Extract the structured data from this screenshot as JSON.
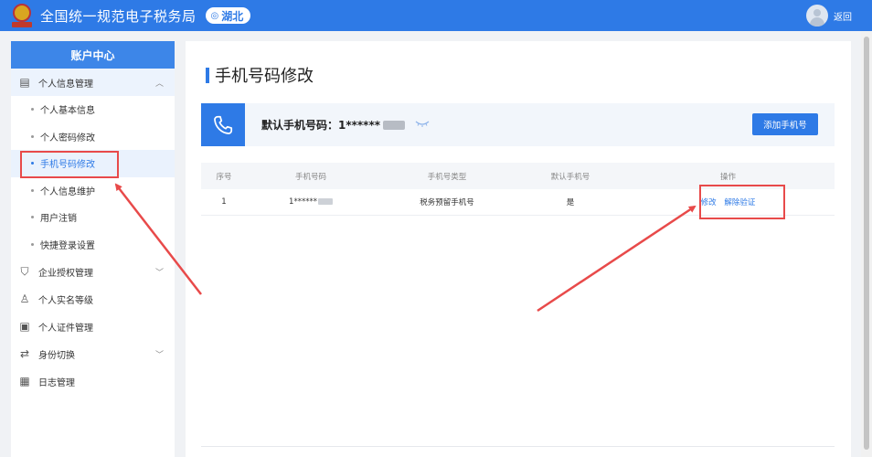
{
  "header": {
    "site_title": "全国统一规范电子税务局",
    "region": "湖北",
    "user_name": "返回"
  },
  "sidebar": {
    "title": "账户中心",
    "group_personal": "个人信息管理",
    "items": [
      "个人基本信息",
      "个人密码修改",
      "手机号码修改",
      "个人信息维护",
      "用户注销",
      "快捷登录设置"
    ],
    "groups": [
      "企业授权管理",
      "个人实名等级",
      "个人证件管理",
      "身份切换",
      "日志管理"
    ]
  },
  "main": {
    "page_title": "手机号码修改",
    "default_phone_label": "默认手机号码：1******",
    "add_button": "添加手机号",
    "table": {
      "headers": [
        "序号",
        "手机号码",
        "手机号类型",
        "默认手机号",
        "操作"
      ],
      "rows": [
        {
          "index": "1",
          "phone": "1******",
          "type": "税务预留手机号",
          "is_default": "是",
          "op_edit": "修改",
          "op_unbind": "解除验证"
        }
      ]
    }
  },
  "colors": {
    "primary": "#2e7ae6",
    "annotation": "#e84a4a"
  }
}
